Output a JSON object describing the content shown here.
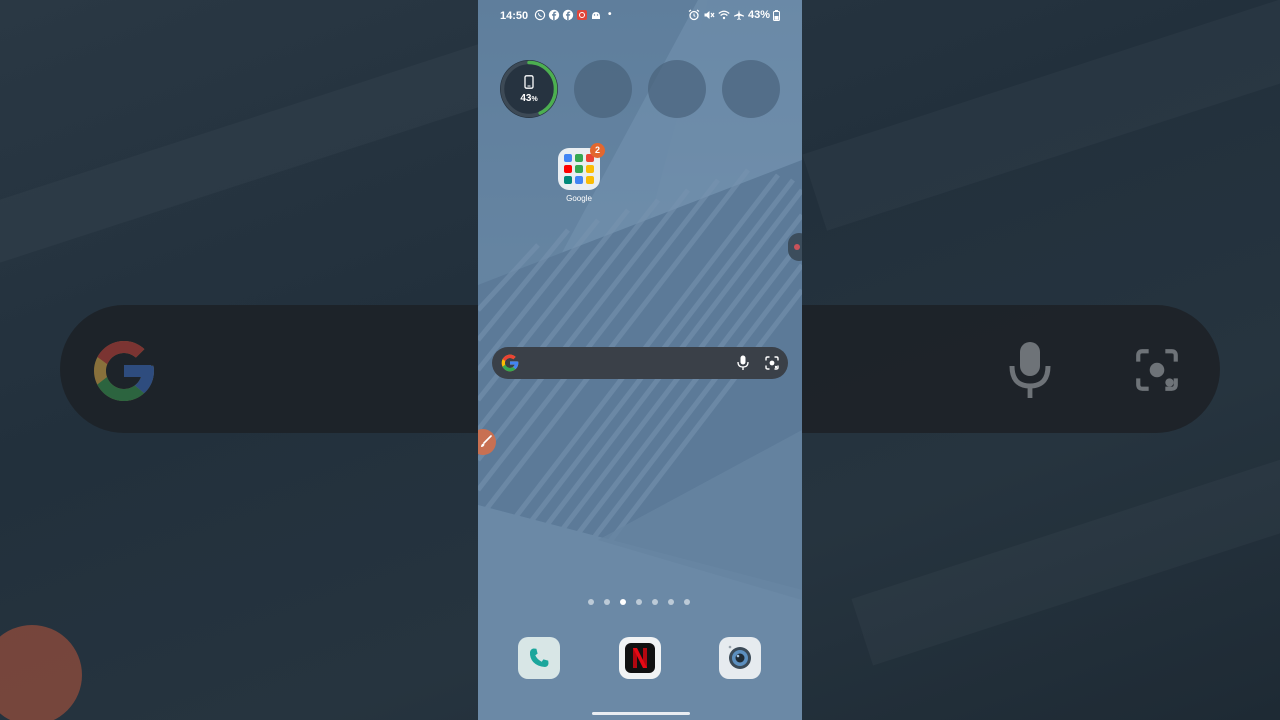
{
  "status_bar": {
    "time": "14:50",
    "notification_icons": [
      "whatsapp-icon",
      "facebook-icon",
      "facebook-icon",
      "app-notification-icon",
      "android-icon"
    ],
    "more_dot": "•",
    "battery_text": "43%",
    "status_icons": [
      "alarm-icon",
      "mute-icon",
      "wifi-icon",
      "airplane-icon",
      "battery-icon"
    ]
  },
  "widgets": {
    "battery_percent_number": "43",
    "battery_percent_unit": "%",
    "battery_level": 0.43,
    "empty_slots": 3
  },
  "folder": {
    "label": "Google",
    "badge": "2"
  },
  "search": {
    "placeholder": ""
  },
  "pages": {
    "count": 7,
    "active_index": 2
  },
  "dock": {
    "apps": [
      "Phone",
      "Netflix",
      "Camera"
    ]
  },
  "colors": {
    "accent_green": "#4caf50",
    "badge": "#e2672f",
    "netflix_red": "#e50914"
  }
}
